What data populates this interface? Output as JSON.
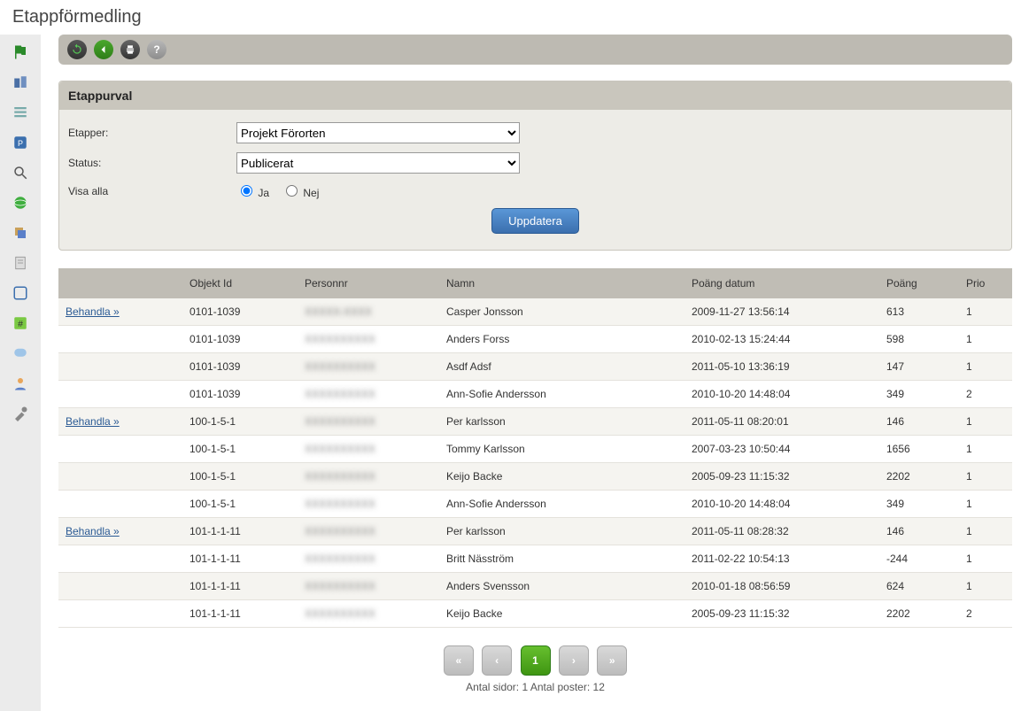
{
  "page_title": "Etappförmedling",
  "panel_title": "Etappurval",
  "form": {
    "etapper_label": "Etapper:",
    "etapper_value": "Projekt Förorten",
    "status_label": "Status:",
    "status_value": "Publicerat",
    "visa_alla_label": "Visa alla",
    "ja_label": "Ja",
    "nej_label": "Nej",
    "update_button": "Uppdatera"
  },
  "columns": {
    "action": "",
    "objekt_id": "Objekt Id",
    "personnr": "Personnr",
    "namn": "Namn",
    "poang_datum": "Poäng datum",
    "poang": "Poäng",
    "prio": "Prio"
  },
  "action_link_label": "Behandla »",
  "rows": [
    {
      "action": true,
      "objekt_id": "0101-1039",
      "personnr": "XXXXX-XXXX",
      "namn": "Casper Jonsson",
      "poang_datum": "2009-11-27 13:56:14",
      "poang": "613",
      "prio": "1"
    },
    {
      "action": false,
      "objekt_id": "0101-1039",
      "personnr": "XXXXXXXXXX",
      "namn": "Anders Forss",
      "poang_datum": "2010-02-13 15:24:44",
      "poang": "598",
      "prio": "1"
    },
    {
      "action": false,
      "objekt_id": "0101-1039",
      "personnr": "XXXXXXXXXX",
      "namn": "Asdf Adsf",
      "poang_datum": "2011-05-10 13:36:19",
      "poang": "147",
      "prio": "1"
    },
    {
      "action": false,
      "objekt_id": "0101-1039",
      "personnr": "XXXXXXXXXX",
      "namn": "Ann-Sofie Andersson",
      "poang_datum": "2010-10-20 14:48:04",
      "poang": "349",
      "prio": "2"
    },
    {
      "action": true,
      "objekt_id": "100-1-5-1",
      "personnr": "XXXXXXXXXX",
      "namn": "Per karlsson",
      "poang_datum": "2011-05-11 08:20:01",
      "poang": "146",
      "prio": "1"
    },
    {
      "action": false,
      "objekt_id": "100-1-5-1",
      "personnr": "XXXXXXXXXX",
      "namn": "Tommy Karlsson",
      "poang_datum": "2007-03-23 10:50:44",
      "poang": "1656",
      "prio": "1"
    },
    {
      "action": false,
      "objekt_id": "100-1-5-1",
      "personnr": "XXXXXXXXXX",
      "namn": "Keijo Backe",
      "poang_datum": "2005-09-23 11:15:32",
      "poang": "2202",
      "prio": "1"
    },
    {
      "action": false,
      "objekt_id": "100-1-5-1",
      "personnr": "XXXXXXXXXX",
      "namn": "Ann-Sofie Andersson",
      "poang_datum": "2010-10-20 14:48:04",
      "poang": "349",
      "prio": "1"
    },
    {
      "action": true,
      "objekt_id": "101-1-1-11",
      "personnr": "XXXXXXXXXX",
      "namn": "Per karlsson",
      "poang_datum": "2011-05-11 08:28:32",
      "poang": "146",
      "prio": "1"
    },
    {
      "action": false,
      "objekt_id": "101-1-1-11",
      "personnr": "XXXXXXXXXX",
      "namn": "Britt Näsström",
      "poang_datum": "2011-02-22 10:54:13",
      "poang": "-244",
      "prio": "1"
    },
    {
      "action": false,
      "objekt_id": "101-1-1-11",
      "personnr": "XXXXXXXXXX",
      "namn": "Anders Svensson",
      "poang_datum": "2010-01-18 08:56:59",
      "poang": "624",
      "prio": "1"
    },
    {
      "action": false,
      "objekt_id": "101-1-1-11",
      "personnr": "XXXXXXXXXX",
      "namn": "Keijo Backe",
      "poang_datum": "2005-09-23 11:15:32",
      "poang": "2202",
      "prio": "2"
    }
  ],
  "pager": {
    "current": "1",
    "info": "Antal sidor: 1 Antal poster: 12"
  }
}
